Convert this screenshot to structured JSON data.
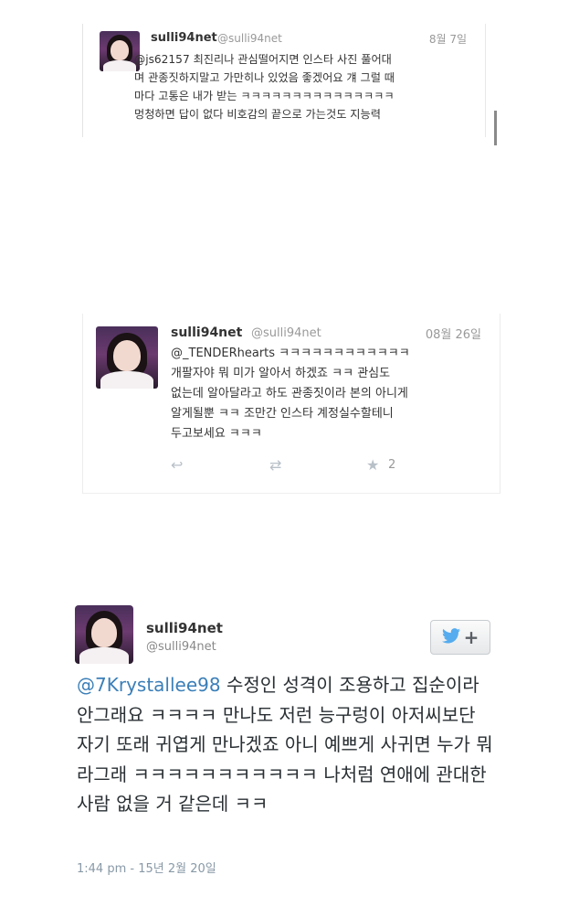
{
  "tweets": [
    {
      "name": "sulli94net",
      "handle": "@sulli94net",
      "date": "8월 7일",
      "text": "@js62157 최진리나 관심떨어지면 인스타 사진 풀어대\n며 관종짓하지말고 가만히나 있었음 좋겠어요 걔 그럴 때\n마다 고통은 내가 받는 ㅋㅋㅋㅋㅋㅋㅋㅋㅋㅋㅋㅋㅋㅋㅋ\n멍청하면 답이 없다 비호감의 끝으로 가는것도 지능력"
    },
    {
      "name": "sulli94net",
      "handle": "@sulli94net",
      "date": "08월 26일",
      "text": "@_TENDERhearts ㅋㅋㅋㅋㅋㅋㅋㅋㅋㅋㅋㅋ\n개팔자야 뭐 미가 알아서 하겠죠 ㅋㅋ 관심도\n없는데 알아달라고 하도 관종짓이라 본의 아니게\n알게될뿐 ㅋㅋ 조만간 인스타 계정실수할테니\n두고보세요 ㅋㅋㅋ",
      "actions": {
        "reply_icon": "reply-icon",
        "retweet_icon": "retweet-icon",
        "favorite_icon": "star-icon",
        "favorite_count": "2"
      }
    }
  ],
  "embed": {
    "name": "sulli94net",
    "handle": "@sulli94net",
    "follow_icon": "twitter-bird-icon",
    "follow_plus": "+",
    "mention": "@7Krystallee98",
    "text": " 수정인 성격이 조용하고 집순이라 안그래요 ㅋㅋㅋㅋ 만나도 저런 능구렁이 아저씨보단 자기 또래 귀엽게 만나겠죠 아니 예쁘게 사귀면 누가 뭐라그래 ㅋㅋㅋㅋㅋㅋㅋㅋㅋㅋㅋ 나처럼 연애에 관대한 사람 없을 거 같은데 ㅋㅋ",
    "timestamp": "1:44 pm - 15년 2월 20일"
  },
  "colors": {
    "link": "#3b7fb8",
    "twitter_blue": "#55acee",
    "muted": "#999999"
  }
}
